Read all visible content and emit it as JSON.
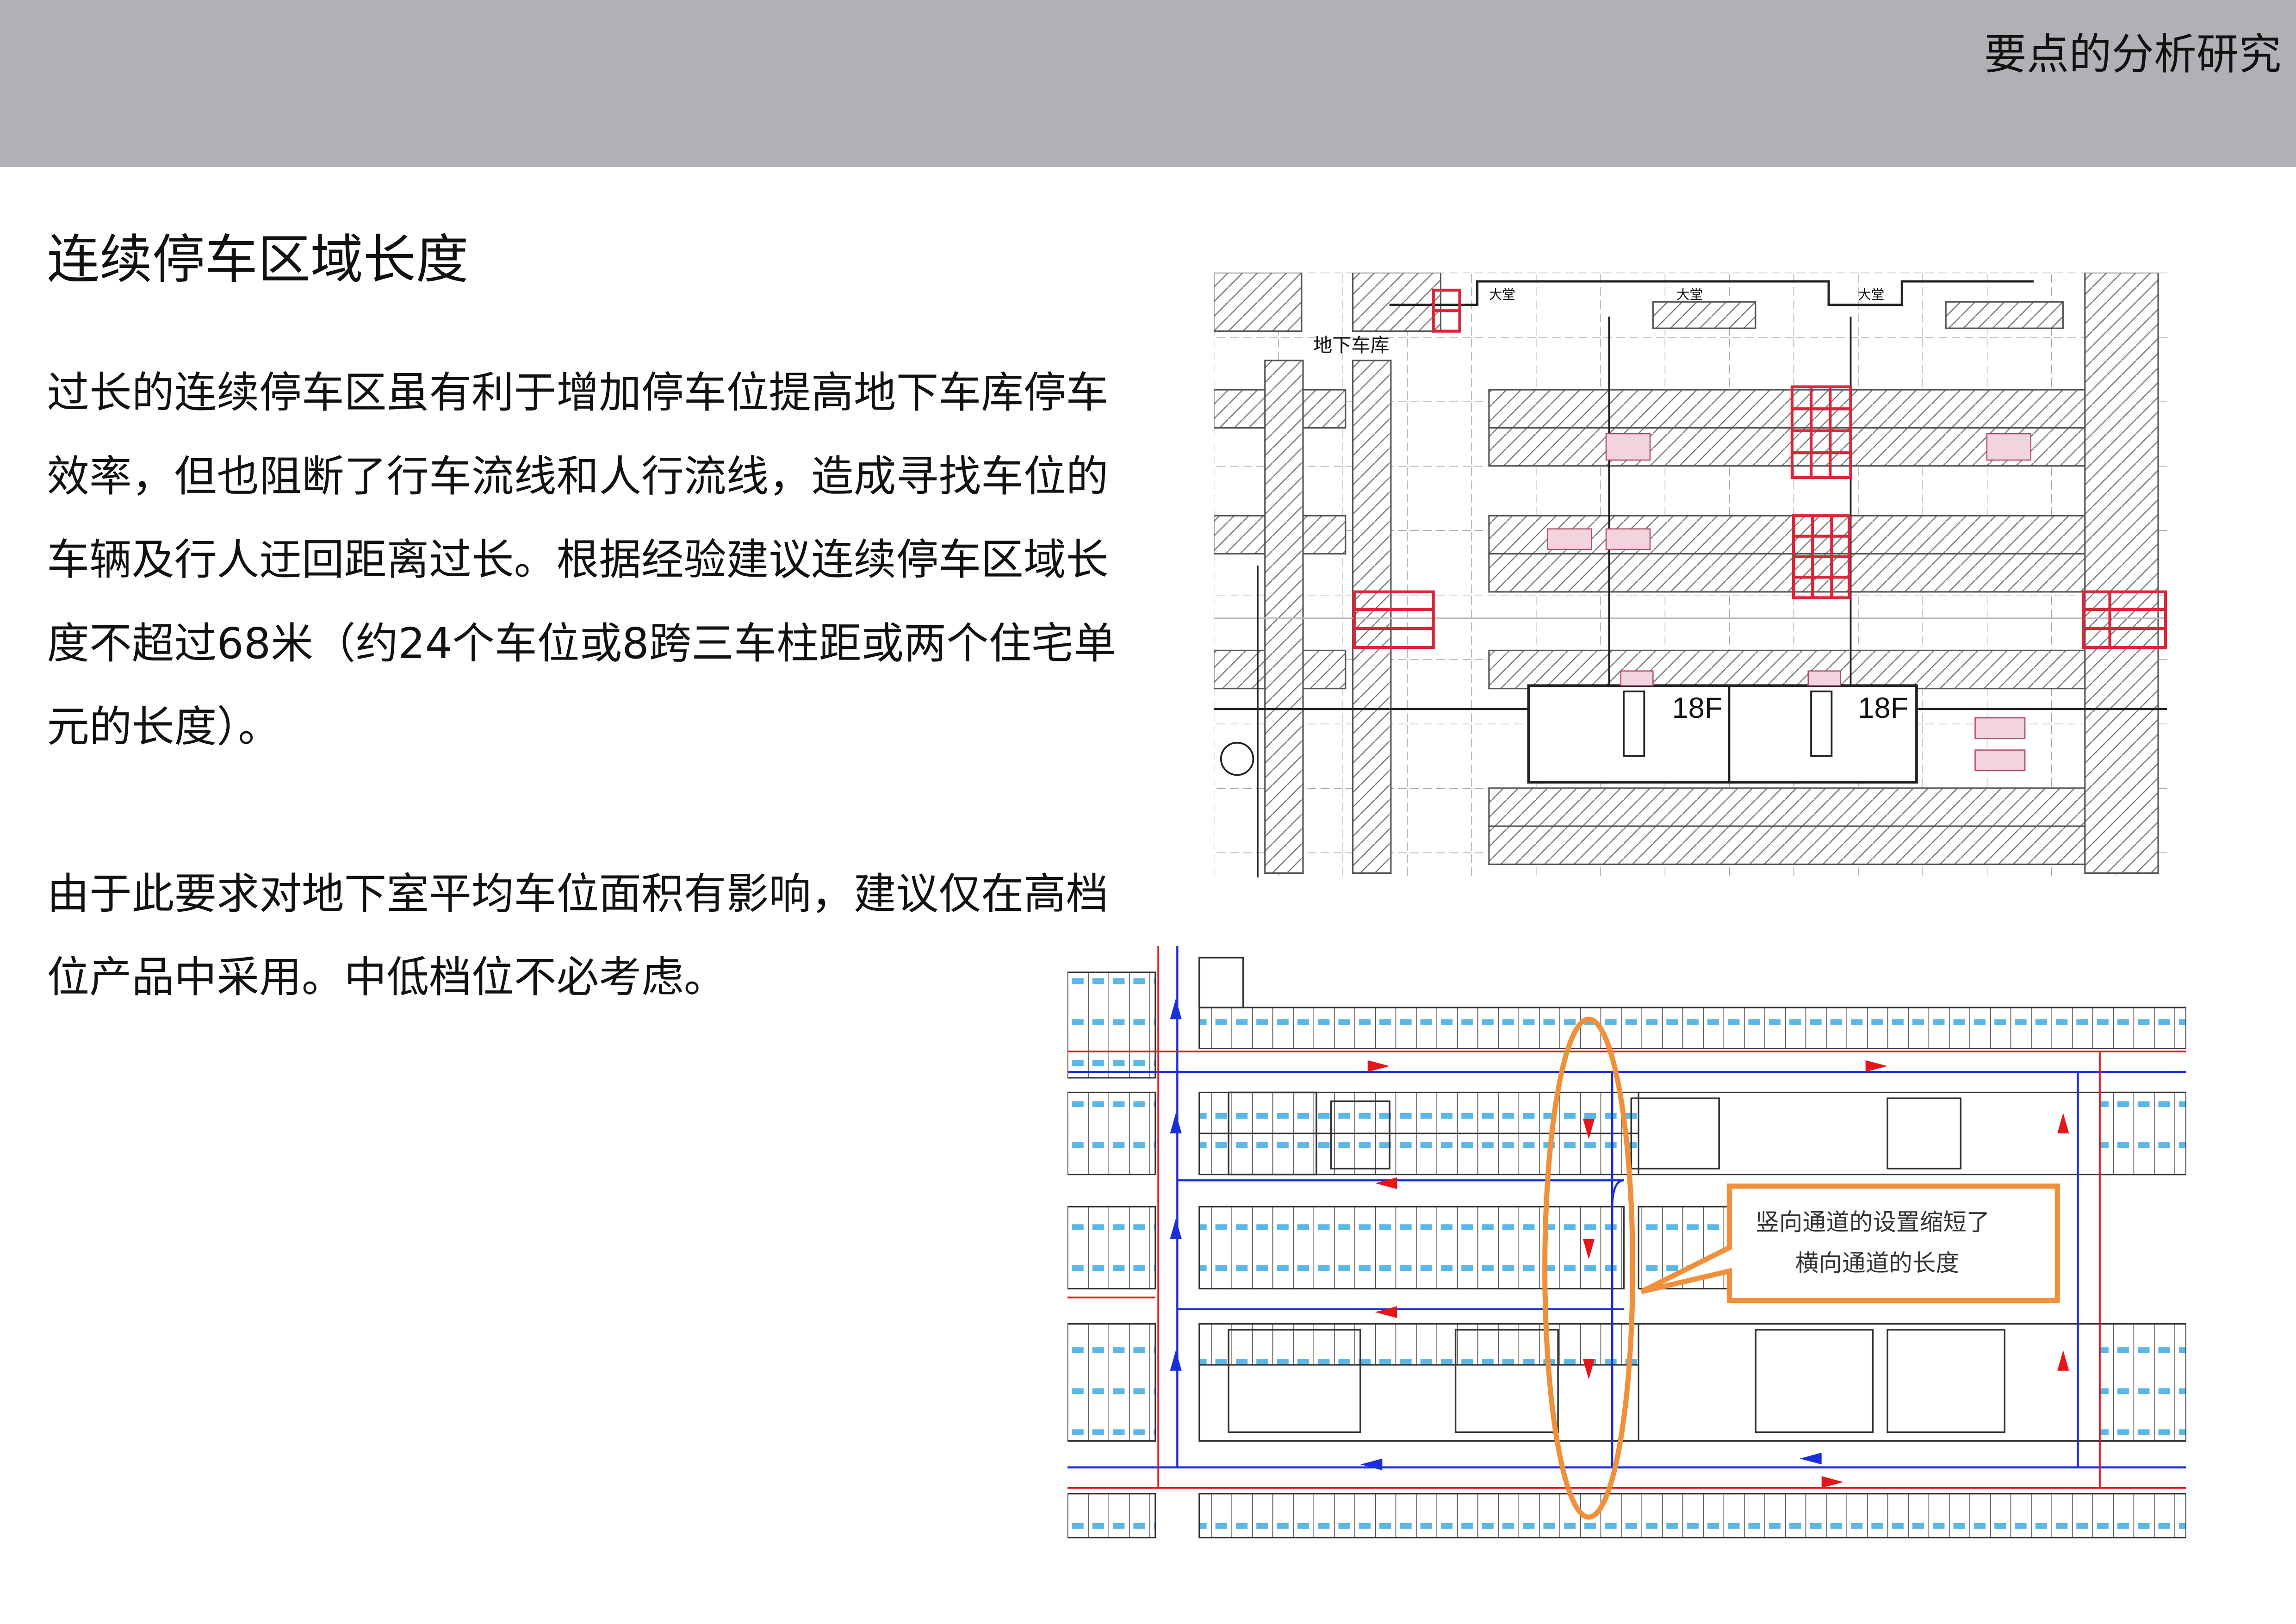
{
  "header": {
    "title": "要点的分析研究"
  },
  "section": {
    "title": "连续停车区域长度"
  },
  "paragraphs": [
    "过长的连续停车区虽有利于增加停车位提高地下车库停车效率，但也阻断了行车流线和人行流线，造成寻找车位的车辆及行人迂回距离过长。根据经验建议连续停车区域长度不超过68米（约24个车位或8跨三车柱距或两个住宅单元的长度）。",
    "由于此要求对地下室平均车位面积有影响，建议仅在高档位产品中采用。中低档位不必考虑。"
  ],
  "plan_top": {
    "area_label": "地下车库",
    "lobby_labels": [
      "大堂",
      "大堂",
      "大堂"
    ],
    "building_labels": [
      "18F",
      "18F"
    ]
  },
  "plan_bottom": {
    "callout_lines": [
      "竖向通道的设置缩短了",
      "横向通道的长度"
    ]
  },
  "colors": {
    "header_bg": "#b1b0b5",
    "callout_orange": "#f0903a",
    "flow_blue": "#1a2fd6",
    "flow_red": "#e8141c",
    "markup_red": "#d8263a"
  }
}
